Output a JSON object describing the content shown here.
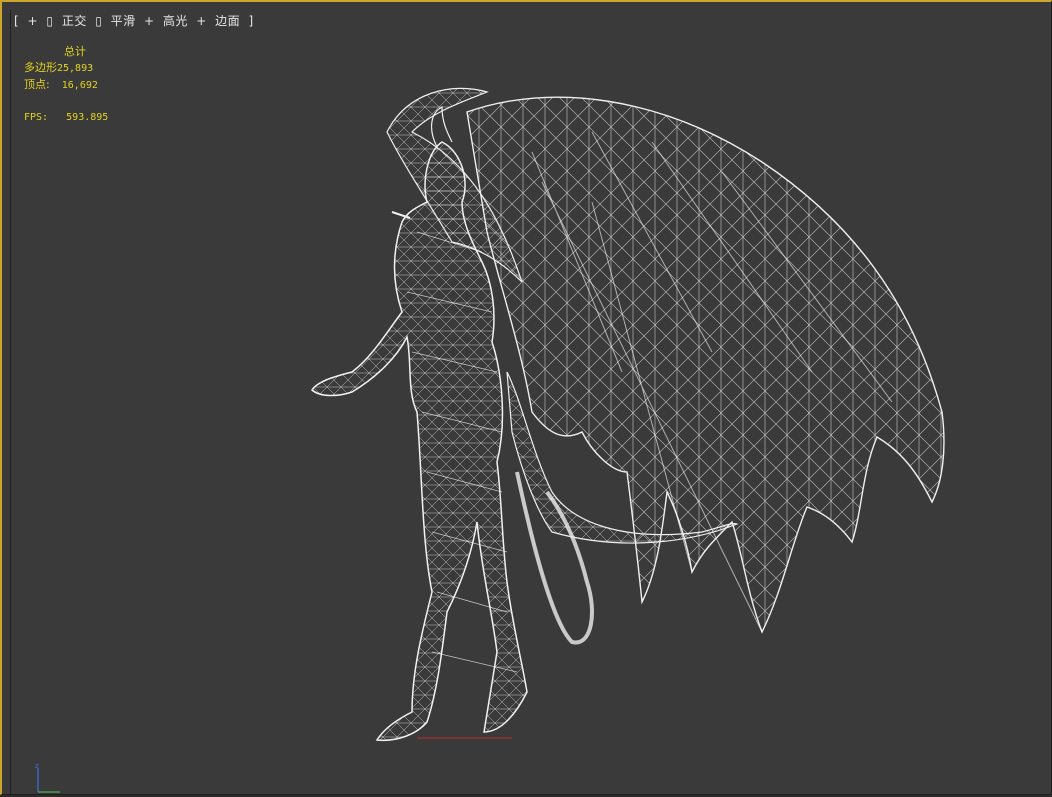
{
  "viewport": {
    "label": {
      "bracket_open": "[",
      "plus1": "+",
      "box1": "▯",
      "view_name": "正交",
      "box2": "▯",
      "shading": "平滑",
      "plus2": "+",
      "highlight": "高光",
      "plus3": "+",
      "edges": "边面",
      "bracket_close": "]"
    },
    "stats": {
      "title": "总计",
      "polygons_label": "多边形",
      "polygons_value": "25,893",
      "vertices_label": "顶点:",
      "vertices_value": "16,692",
      "fps_label": "FPS:",
      "fps_value": "593.895"
    }
  },
  "colors": {
    "viewport_bg": "#3a3a3a",
    "active_border": "#caa72a",
    "stats_text": "#e3d420",
    "wireframe": "#e8e8e8",
    "axis_z": "#3a6fe0",
    "ground_marker": "#c0282a"
  },
  "icons": {
    "model": "wireframe-demon-figure-icon",
    "axis": "axis-gizmo-icon"
  }
}
